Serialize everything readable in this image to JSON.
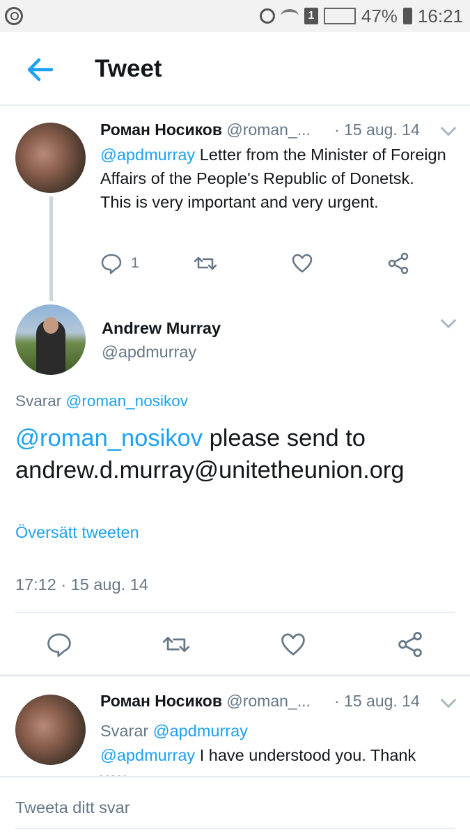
{
  "status_bar": {
    "battery": "47%",
    "time": "16:21",
    "sim_badge": "1",
    "icons": [
      "search-icon",
      "alarm-icon",
      "wifi-icon",
      "signal-icon",
      "battery-icon"
    ]
  },
  "header": {
    "title": "Tweet",
    "back_icon": "arrow-left-icon"
  },
  "tweet_prev": {
    "name": "Роман Носиков",
    "handle": "@roman_...",
    "date": "· 15 aug. 14",
    "mention": "@apdmurray",
    "text": " Letter from the Minister of Foreign Affairs of the People's Republic of Donetsk. This is very important and very urgent.",
    "reply_count": "1"
  },
  "main_tweet": {
    "name": "Andrew Murray",
    "handle": "@apdmurray",
    "replying_label": "Svarar",
    "replying_to": "@roman_nosikov",
    "mention": "@roman_nosikov",
    "text_line1": " please send to",
    "text_line2": "andrew.d.murray@unitetheunion.org",
    "translate": "Översätt tweeten",
    "timestamp": "17:12 · 15 aug. 14"
  },
  "tweet_next": {
    "name": "Роман Носиков",
    "handle": "@roman_...",
    "date": "· 15 aug. 14",
    "replying_label": "Svarar",
    "replying_to": "@apdmurray",
    "mention": "@apdmurray",
    "text": " I have understood you. Thank you."
  },
  "reply_bar": {
    "placeholder": "Tweeta ditt svar"
  },
  "colors": {
    "accent": "#1da1f2",
    "text": "#14171a",
    "secondary": "#657786",
    "divider": "#e6ecf0"
  }
}
